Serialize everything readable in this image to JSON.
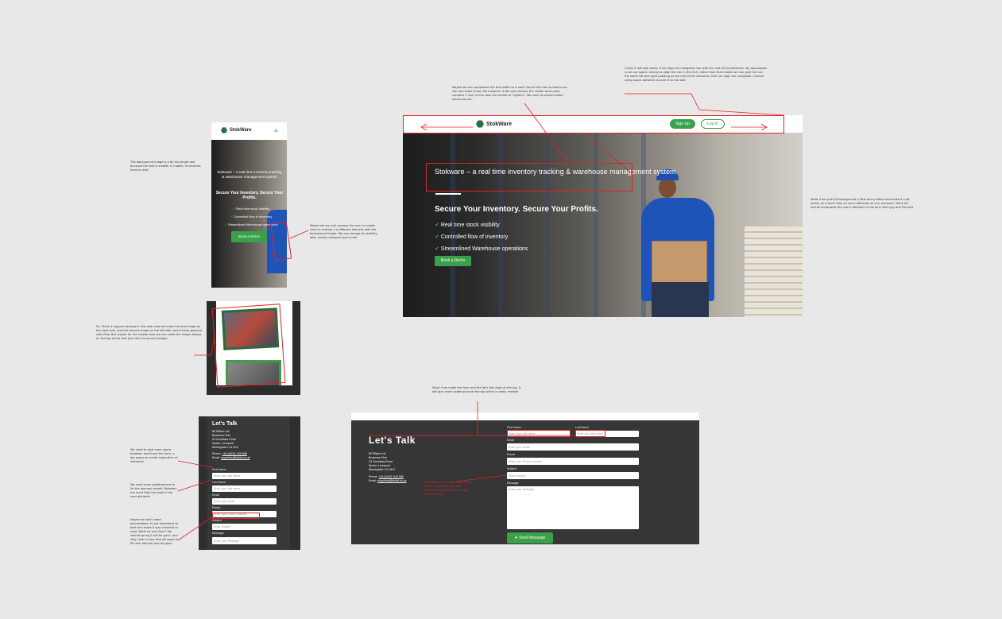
{
  "annotations": {
    "nav_note": "I think it will look better if we align the navigation bar with the rest of the elements. My assumption is we use space- evenly to align the nav in the CSS, rather than that maybe we can give the nav the same left and right padding as the rest of the elements, then we align the navigation content using space-between to push it to the side",
    "title_note": "Maybe we can complicate the text width so it won't touch the man so bad so we can and make it two line instance. It will also remove the visible word (now contains a line) in this case the similar to \"system\". We have to present wider words we can",
    "blur_note": "What if we give the background a little blurry effect and make it a bit darker so it won't take as much attention as it is, because I think we should emphasize the user's attention is the blue shirt guy and the text",
    "mobile_bg_note": "The background image is a bit too bright and because the text is smaller in mobile, it becomes hard to read",
    "mobile_man_note": "Maybe we can just remove the man in mobile view by making it a different element with the background image. We can change its visibility after certain viewport size is met",
    "gallery_note": "So I think it happen because in the web view we make the first image on the right side, and the second image on the left side, and it looks good on web-View. But maybe for the mobile view we can make the image always on the top of the text (just like the second image)",
    "spacing_note": "We need to give more space between email and the form, a big space to create separation of elements",
    "padding_note": "We need more padding here to let the element breath. Between the input field the label is the next attribute",
    "placeholder_note": "Maybe we don't need placeholders. It just redundant at best and make it way crowded to read. What do you think? We should spring it will be gone, and stay clean in tips that we gave to fill their field be also be gone",
    "form_note": "What if we make the form and the let's talk align at the top. It will give more padding too at the top which is really needed",
    "contact_note": "the address info might look like a block, maybe we can give margin between them to keep the hierarchy"
  },
  "desktop_hero": {
    "brand": "StokWare",
    "signup": "Sign Up",
    "login": "Log In",
    "title": "Stokware – a real time inventory tracking & warehouse management system",
    "headline": "Secure Your Inventory. Secure Your Profits.",
    "features": [
      "Real time stock visibility",
      "Controlled flow of inventory",
      "Streamlined Warehouse operations"
    ],
    "cta": "Book a Demo"
  },
  "mobile_hero": {
    "brand": "StokWare",
    "title": "Stokware – a real time inventory tracking & warehouse management system",
    "headline": "Secure Your Inventory. Secure Your Profits.",
    "features": [
      "Real time stock visibility",
      "Controlled flow of inventory",
      "Streamlined Warehouse operations"
    ],
    "cta": "Book a Demo"
  },
  "lets_talk": {
    "heading": "Let's Talk",
    "company": "BFSWare Ltd",
    "address": [
      "Business First",
      "23 Goodlass Road",
      "Speke, Liverpool",
      "Merseyside L24 9HJ"
    ],
    "phone_label": "Phone:",
    "phone": "+44 (0)151 546 885",
    "email_label": "Email:",
    "email": "enquiries@bfsltd.co.uk",
    "labels": {
      "first": "First Name",
      "last": "Last Name",
      "email": "Email",
      "phone": "Phone",
      "subject": "Subject",
      "message": "Message"
    },
    "placeholders": {
      "first": "Enter your first name",
      "last": "Enter your last name",
      "email": "Enter your email",
      "phone": "Enter your Phone Number",
      "subject": "Enter Subject",
      "message": "Enter your Message"
    },
    "send": "Send Message"
  },
  "colors": {
    "accent": "#3aa04a",
    "annotation": "#e02424",
    "dark_panel": "#363636"
  }
}
